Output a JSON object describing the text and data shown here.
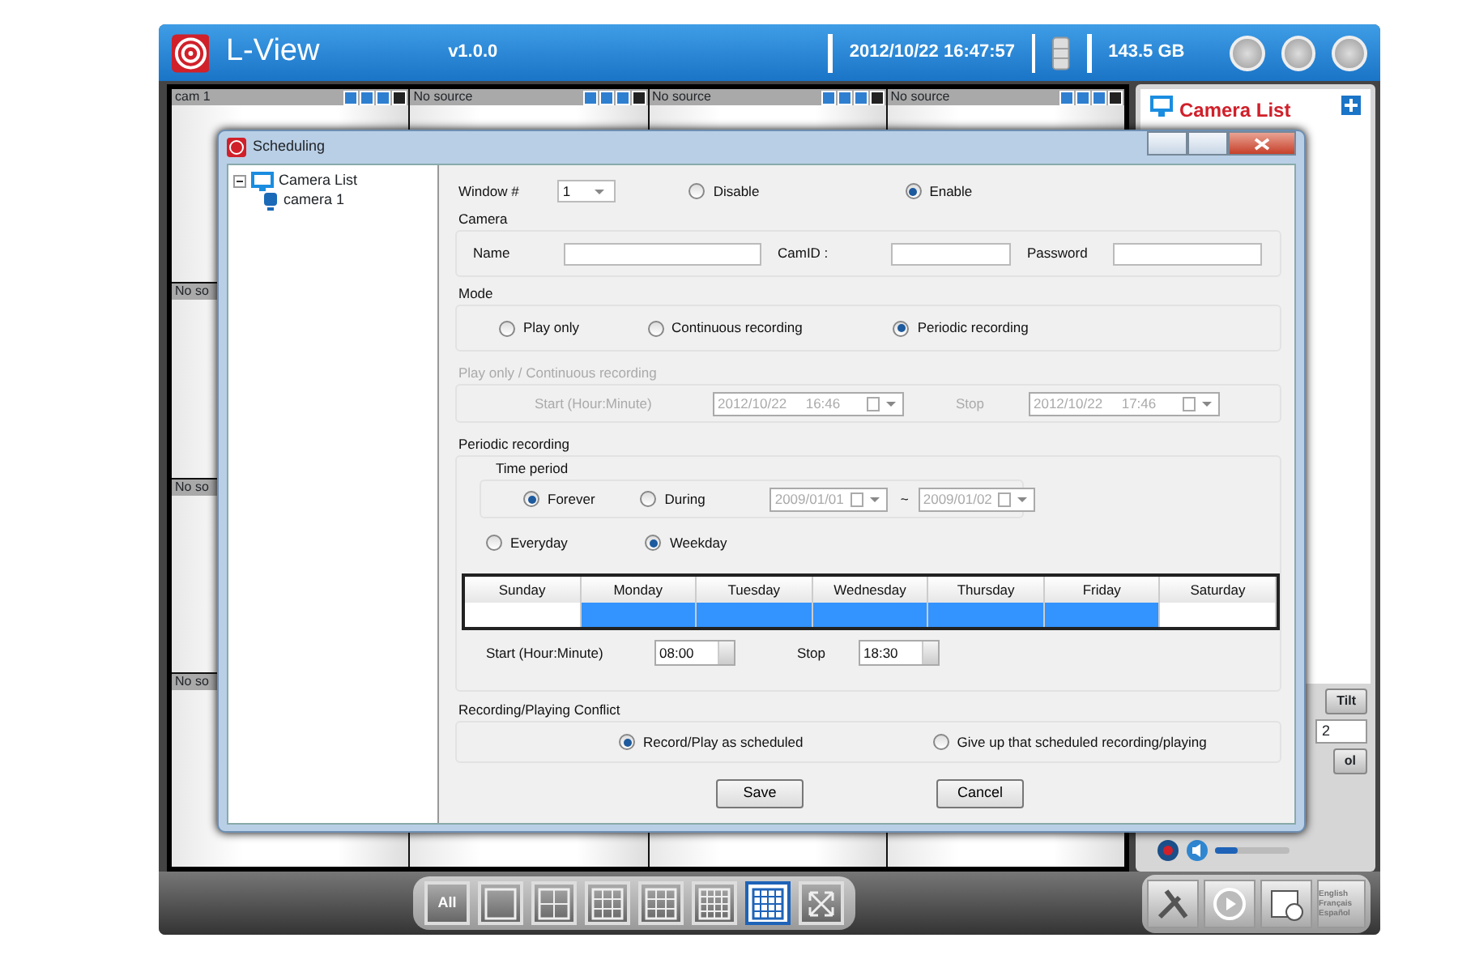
{
  "app": {
    "title": "L-View",
    "version": "v1.0.0",
    "datetime": "2012/10/22 16:47:57",
    "storage": "143.5 GB"
  },
  "video_grid": [
    [
      "cam 1",
      "No source",
      "No source",
      "No source"
    ],
    [
      "No so"
    ],
    [
      "No so"
    ],
    [
      "No so"
    ]
  ],
  "camera_panel": {
    "title": "Camera List",
    "tilt_button": "Tilt",
    "preset": "2",
    "control_button": "ol",
    "volume": {
      "level": 0.3
    }
  },
  "layout_buttons": [
    {
      "kind": "all",
      "label": "All",
      "selected": false
    },
    {
      "kind": "grid1",
      "selected": false
    },
    {
      "kind": "grid4",
      "selected": false
    },
    {
      "kind": "grid6",
      "selected": false
    },
    {
      "kind": "grid9",
      "selected": false
    },
    {
      "kind": "grid13",
      "selected": false
    },
    {
      "kind": "grid16",
      "selected": true
    },
    {
      "kind": "full",
      "selected": false
    }
  ],
  "language_button": "English Français Español",
  "dialog": {
    "title": "Scheduling",
    "tree": [
      {
        "label": "Camera List",
        "expanded": true,
        "children": [
          {
            "label": "camera 1"
          }
        ]
      }
    ],
    "window_label": "Window #",
    "window_value": "1",
    "window_state": [
      {
        "label": "Disable",
        "selected": false
      },
      {
        "label": "Enable",
        "selected": true
      }
    ],
    "camera": {
      "title": "Camera",
      "fields": [
        {
          "label": "Name"
        },
        {
          "label": "CamID :"
        },
        {
          "label": "Password"
        }
      ]
    },
    "mode": {
      "title": "Mode",
      "options": [
        {
          "label": "Play only",
          "selected": false
        },
        {
          "label": "Continuous recording",
          "selected": false
        },
        {
          "label": "Periodic recording",
          "selected": true
        }
      ]
    },
    "play_continuous": {
      "title": "Play only / Continuous recording",
      "disabled": true,
      "start_label": "Start (Hour:Minute)",
      "start_value": "2012/10/22     16:46",
      "stop_label": "Stop",
      "stop_value": "2012/10/22     17:46"
    },
    "periodic": {
      "title": "Periodic recording",
      "time_period": {
        "title": "Time period",
        "options": [
          {
            "label": "Forever",
            "selected": true
          },
          {
            "label": "During",
            "selected": false
          }
        ],
        "from": "2009/01/01",
        "separator": "~",
        "to": "2009/01/02",
        "disabled": true
      },
      "day_mode": [
        {
          "label": "Everyday",
          "selected": false
        },
        {
          "label": "Weekday",
          "selected": true
        }
      ],
      "days": [
        {
          "label": "Sunday",
          "selected": false
        },
        {
          "label": "Monday",
          "selected": true
        },
        {
          "label": "Tuesday",
          "selected": true
        },
        {
          "label": "Wednesday",
          "selected": true
        },
        {
          "label": "Thursday",
          "selected": true
        },
        {
          "label": "Friday",
          "selected": true
        },
        {
          "label": "Saturday",
          "selected": false
        }
      ],
      "start_label": "Start (Hour:Minute)",
      "start_value": "08:00",
      "stop_label": "Stop",
      "stop_value": "18:30"
    },
    "conflict": {
      "title": "Recording/Playing Conflict",
      "options": [
        {
          "label": "Record/Play as scheduled",
          "selected": true
        },
        {
          "label": "Give up that scheduled recording/playing",
          "selected": false
        }
      ]
    },
    "buttons": [
      "Save",
      "Cancel"
    ]
  }
}
